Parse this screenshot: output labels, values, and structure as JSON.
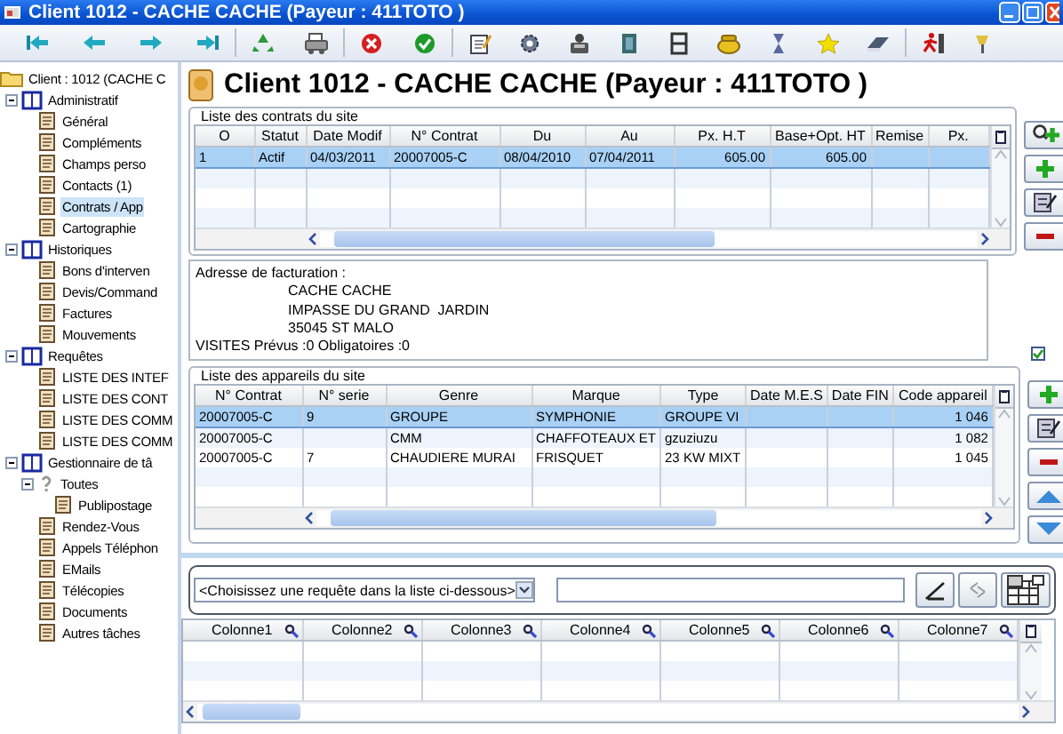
{
  "window": {
    "title": "Client 1012 - CACHE CACHE (Payeur : 411TOTO )"
  },
  "tree": {
    "label": "Client : 1012 (CACHE C",
    "selected": false,
    "children": [
      {
        "label": "Administratif",
        "expanded": true,
        "selected": false,
        "children": [
          {
            "label": "Général",
            "selected": false
          },
          {
            "label": "Compléments",
            "selected": false
          },
          {
            "label": "Champs perso",
            "selected": false
          },
          {
            "label": "Contacts (1)",
            "selected": false
          },
          {
            "label": "Contrats / App",
            "selected": true
          },
          {
            "label": "Cartographie",
            "selected": false
          }
        ]
      },
      {
        "label": "Historiques",
        "expanded": true,
        "selected": false,
        "children": [
          {
            "label": "Bons d'interven",
            "selected": false
          },
          {
            "label": "Devis/Command",
            "selected": false
          },
          {
            "label": "Factures",
            "selected": false
          },
          {
            "label": "Mouvements",
            "selected": false
          }
        ]
      },
      {
        "label": "Requêtes",
        "expanded": true,
        "selected": false,
        "children": [
          {
            "label": "LISTE DES INTEF",
            "selected": false
          },
          {
            "label": "LISTE DES CONT",
            "selected": false
          },
          {
            "label": "LISTE DES COMM",
            "selected": false
          },
          {
            "label": "LISTE DES COMM",
            "selected": false
          }
        ]
      },
      {
        "label": "Gestionnaire de tâ",
        "expanded": true,
        "selected": false,
        "children": [
          {
            "label": "Toutes",
            "expanded": true,
            "selected": false,
            "children": [
              {
                "label": "Publipostage",
                "selected": false
              }
            ]
          },
          {
            "label": "Rendez-Vous",
            "selected": false
          },
          {
            "label": "Appels Téléphon",
            "selected": false
          },
          {
            "label": "EMails",
            "selected": false
          },
          {
            "label": "Télécopies",
            "selected": false
          },
          {
            "label": "Documents",
            "selected": false
          },
          {
            "label": "Autres tâches",
            "selected": false
          }
        ]
      }
    ]
  },
  "header": {
    "title": "Client 1012 - CACHE CACHE (Payeur : 411TOTO )"
  },
  "contracts": {
    "title": "Liste des contrats du site",
    "columns": [
      "O",
      "Statut",
      "Date Modif",
      "N° Contrat",
      "Du",
      "Au",
      "Px. H.T",
      "Base+Opt. HT",
      "Remise",
      "Px."
    ],
    "rows": [
      {
        "cells": [
          "1",
          "Actif",
          "04/03/2011",
          "20007005-C",
          "08/04/2010",
          "07/04/2011",
          "605.00",
          "605.00",
          null,
          null
        ],
        "selected": true
      }
    ]
  },
  "address": {
    "label": "Adresse de facturation :",
    "lines": [
      "CACHE CACHE",
      "IMPASSE DU GRAND  JARDIN",
      "35045 ST MALO"
    ],
    "visits": "VISITES Prévus :0 Obligatoires :0"
  },
  "show_all": {
    "checked": true
  },
  "devices": {
    "title": "Liste des appareils du site",
    "columns": [
      "N° Contrat",
      "N° serie",
      "Genre",
      "Marque",
      "Type",
      "Date M.E.S",
      "Date FIN",
      "Code appareil"
    ],
    "rows": [
      {
        "cells": [
          "20007005-C",
          "9",
          "GROUPE",
          "SYMPHONIE",
          "GROUPE VI",
          null,
          null,
          "1 046"
        ],
        "selected": true
      },
      {
        "cells": [
          "20007005-C",
          null,
          "CMM",
          "CHAFFOTEAUX ET",
          "gzuziuzu",
          null,
          null,
          "1 082"
        ],
        "selected": false
      },
      {
        "cells": [
          "20007005-C",
          "7",
          "CHAUDIERE MURAI",
          "FRISQUET",
          "23 KW MIXT",
          null,
          null,
          "1 045"
        ],
        "selected": false
      }
    ]
  },
  "query": {
    "dropdown": "<Choisissez une requête dans la liste ci-dessous>",
    "columns": [
      "Colonne1",
      "Colonne2",
      "Colonne3",
      "Colonne4",
      "Colonne5",
      "Colonne6",
      "Colonne7"
    ]
  }
}
